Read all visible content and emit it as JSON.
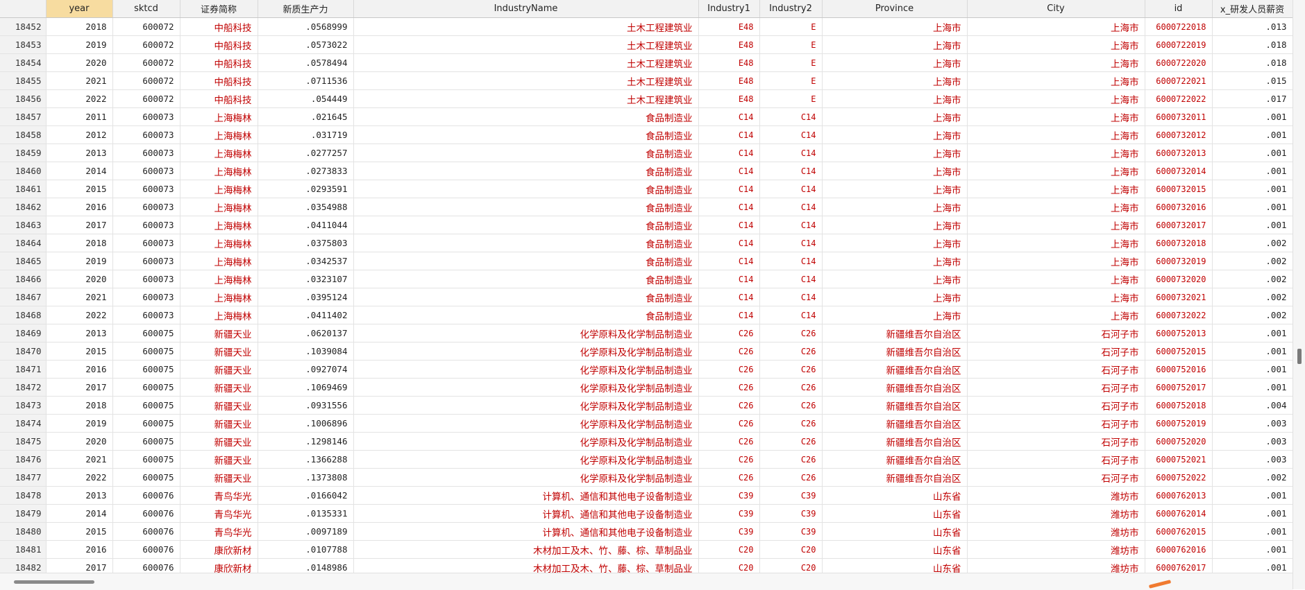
{
  "columns": [
    "",
    "year",
    "sktcd",
    "证券简称",
    "新质生产力",
    "IndustryName",
    "Industry1",
    "Industry2",
    "Province",
    "City",
    "id",
    "x_研发人员薪资"
  ],
  "selected_column": "year",
  "rows": [
    [
      "18452",
      "2018",
      "600072",
      "中船科技",
      ".0568999",
      "土木工程建筑业",
      "E48",
      "E",
      "上海市",
      "上海市",
      "6000722018",
      ".013"
    ],
    [
      "18453",
      "2019",
      "600072",
      "中船科技",
      ".0573022",
      "土木工程建筑业",
      "E48",
      "E",
      "上海市",
      "上海市",
      "6000722019",
      ".018"
    ],
    [
      "18454",
      "2020",
      "600072",
      "中船科技",
      ".0578494",
      "土木工程建筑业",
      "E48",
      "E",
      "上海市",
      "上海市",
      "6000722020",
      ".018"
    ],
    [
      "18455",
      "2021",
      "600072",
      "中船科技",
      ".0711536",
      "土木工程建筑业",
      "E48",
      "E",
      "上海市",
      "上海市",
      "6000722021",
      ".015"
    ],
    [
      "18456",
      "2022",
      "600072",
      "中船科技",
      ".054449",
      "土木工程建筑业",
      "E48",
      "E",
      "上海市",
      "上海市",
      "6000722022",
      ".017"
    ],
    [
      "18457",
      "2011",
      "600073",
      "上海梅林",
      ".021645",
      "食品制造业",
      "C14",
      "C14",
      "上海市",
      "上海市",
      "6000732011",
      ".001"
    ],
    [
      "18458",
      "2012",
      "600073",
      "上海梅林",
      ".031719",
      "食品制造业",
      "C14",
      "C14",
      "上海市",
      "上海市",
      "6000732012",
      ".001"
    ],
    [
      "18459",
      "2013",
      "600073",
      "上海梅林",
      ".0277257",
      "食品制造业",
      "C14",
      "C14",
      "上海市",
      "上海市",
      "6000732013",
      ".001"
    ],
    [
      "18460",
      "2014",
      "600073",
      "上海梅林",
      ".0273833",
      "食品制造业",
      "C14",
      "C14",
      "上海市",
      "上海市",
      "6000732014",
      ".001"
    ],
    [
      "18461",
      "2015",
      "600073",
      "上海梅林",
      ".0293591",
      "食品制造业",
      "C14",
      "C14",
      "上海市",
      "上海市",
      "6000732015",
      ".001"
    ],
    [
      "18462",
      "2016",
      "600073",
      "上海梅林",
      ".0354988",
      "食品制造业",
      "C14",
      "C14",
      "上海市",
      "上海市",
      "6000732016",
      ".001"
    ],
    [
      "18463",
      "2017",
      "600073",
      "上海梅林",
      ".0411044",
      "食品制造业",
      "C14",
      "C14",
      "上海市",
      "上海市",
      "6000732017",
      ".001"
    ],
    [
      "18464",
      "2018",
      "600073",
      "上海梅林",
      ".0375803",
      "食品制造业",
      "C14",
      "C14",
      "上海市",
      "上海市",
      "6000732018",
      ".002"
    ],
    [
      "18465",
      "2019",
      "600073",
      "上海梅林",
      ".0342537",
      "食品制造业",
      "C14",
      "C14",
      "上海市",
      "上海市",
      "6000732019",
      ".002"
    ],
    [
      "18466",
      "2020",
      "600073",
      "上海梅林",
      ".0323107",
      "食品制造业",
      "C14",
      "C14",
      "上海市",
      "上海市",
      "6000732020",
      ".002"
    ],
    [
      "18467",
      "2021",
      "600073",
      "上海梅林",
      ".0395124",
      "食品制造业",
      "C14",
      "C14",
      "上海市",
      "上海市",
      "6000732021",
      ".002"
    ],
    [
      "18468",
      "2022",
      "600073",
      "上海梅林",
      ".0411402",
      "食品制造业",
      "C14",
      "C14",
      "上海市",
      "上海市",
      "6000732022",
      ".002"
    ],
    [
      "18469",
      "2013",
      "600075",
      "新疆天业",
      ".0620137",
      "化学原料及化学制品制造业",
      "C26",
      "C26",
      "新疆维吾尔自治区",
      "石河子市",
      "6000752013",
      ".001"
    ],
    [
      "18470",
      "2015",
      "600075",
      "新疆天业",
      ".1039084",
      "化学原料及化学制品制造业",
      "C26",
      "C26",
      "新疆维吾尔自治区",
      "石河子市",
      "6000752015",
      ".001"
    ],
    [
      "18471",
      "2016",
      "600075",
      "新疆天业",
      ".0927074",
      "化学原料及化学制品制造业",
      "C26",
      "C26",
      "新疆维吾尔自治区",
      "石河子市",
      "6000752016",
      ".001"
    ],
    [
      "18472",
      "2017",
      "600075",
      "新疆天业",
      ".1069469",
      "化学原料及化学制品制造业",
      "C26",
      "C26",
      "新疆维吾尔自治区",
      "石河子市",
      "6000752017",
      ".001"
    ],
    [
      "18473",
      "2018",
      "600075",
      "新疆天业",
      ".0931556",
      "化学原料及化学制品制造业",
      "C26",
      "C26",
      "新疆维吾尔自治区",
      "石河子市",
      "6000752018",
      ".004"
    ],
    [
      "18474",
      "2019",
      "600075",
      "新疆天业",
      ".1006896",
      "化学原料及化学制品制造业",
      "C26",
      "C26",
      "新疆维吾尔自治区",
      "石河子市",
      "6000752019",
      ".003"
    ],
    [
      "18475",
      "2020",
      "600075",
      "新疆天业",
      ".1298146",
      "化学原料及化学制品制造业",
      "C26",
      "C26",
      "新疆维吾尔自治区",
      "石河子市",
      "6000752020",
      ".003"
    ],
    [
      "18476",
      "2021",
      "600075",
      "新疆天业",
      ".1366288",
      "化学原料及化学制品制造业",
      "C26",
      "C26",
      "新疆维吾尔自治区",
      "石河子市",
      "6000752021",
      ".003"
    ],
    [
      "18477",
      "2022",
      "600075",
      "新疆天业",
      ".1373808",
      "化学原料及化学制品制造业",
      "C26",
      "C26",
      "新疆维吾尔自治区",
      "石河子市",
      "6000752022",
      ".002"
    ],
    [
      "18478",
      "2013",
      "600076",
      "青鸟华光",
      ".0166042",
      "计算机、通信和其他电子设备制造业",
      "C39",
      "C39",
      "山东省",
      "潍坊市",
      "6000762013",
      ".001"
    ],
    [
      "18479",
      "2014",
      "600076",
      "青鸟华光",
      ".0135331",
      "计算机、通信和其他电子设备制造业",
      "C39",
      "C39",
      "山东省",
      "潍坊市",
      "6000762014",
      ".001"
    ],
    [
      "18480",
      "2015",
      "600076",
      "青鸟华光",
      ".0097189",
      "计算机、通信和其他电子设备制造业",
      "C39",
      "C39",
      "山东省",
      "潍坊市",
      "6000762015",
      ".001"
    ],
    [
      "18481",
      "2016",
      "600076",
      "康欣新材",
      ".0107788",
      "木材加工及木、竹、藤、棕、草制品业",
      "C20",
      "C20",
      "山东省",
      "潍坊市",
      "6000762016",
      ".001"
    ],
    [
      "18482",
      "2017",
      "600076",
      "康欣新材",
      ".0148986",
      "木材加工及木、竹、藤、棕、草制品业",
      "C20",
      "C20",
      "山东省",
      "潍坊市",
      "6000762017",
      ".001"
    ]
  ]
}
